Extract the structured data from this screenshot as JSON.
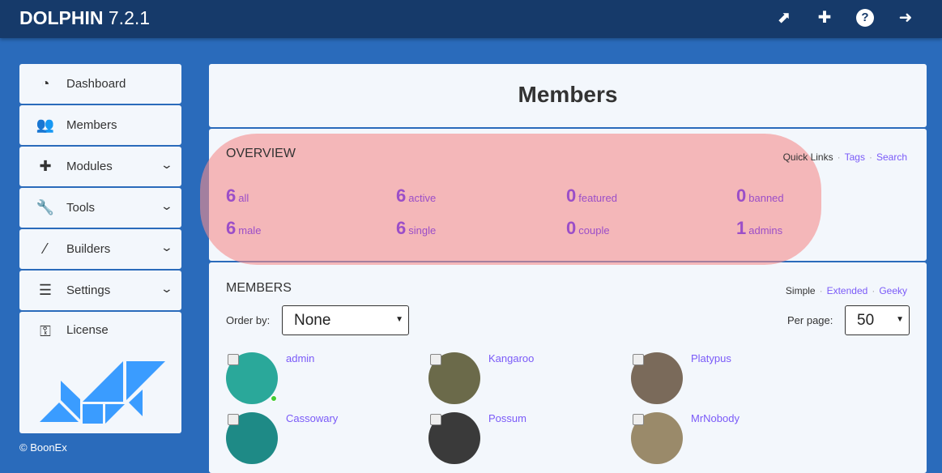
{
  "header": {
    "brand": "DOLPHIN",
    "version": "7.2.1"
  },
  "sidebar": {
    "items": [
      {
        "label": "Dashboard",
        "icon": "dashboard-icon",
        "glyph": "◔"
      },
      {
        "label": "Members",
        "icon": "users-icon",
        "glyph": "👥"
      },
      {
        "label": "Modules",
        "icon": "puzzle-icon",
        "glyph": "✚"
      },
      {
        "label": "Tools",
        "icon": "wrench-icon",
        "glyph": "🔧"
      },
      {
        "label": "Builders",
        "icon": "magic-wand-icon",
        "glyph": "⁄"
      },
      {
        "label": "Settings",
        "icon": "sliders-icon",
        "glyph": "☰"
      },
      {
        "label": "License",
        "icon": "key-icon",
        "glyph": "⚿"
      }
    ],
    "copyright": "© BoonEx"
  },
  "page": {
    "title": "Members"
  },
  "overview": {
    "title": "OVERVIEW",
    "quick_links": "Quick Links",
    "links": [
      "Tags",
      "Search"
    ],
    "stats": [
      {
        "n": "6",
        "l": "all"
      },
      {
        "n": "6",
        "l": "active"
      },
      {
        "n": "0",
        "l": "featured"
      },
      {
        "n": "0",
        "l": "banned"
      },
      {
        "n": "6",
        "l": "male"
      },
      {
        "n": "6",
        "l": "single"
      },
      {
        "n": "0",
        "l": "couple"
      },
      {
        "n": "1",
        "l": "admins"
      }
    ]
  },
  "members": {
    "title": "MEMBERS",
    "view_current": "Simple",
    "views": [
      "Extended",
      "Geeky"
    ],
    "order_label": "Order by:",
    "order_value": "None",
    "per_page_label": "Per page:",
    "per_page_value": "50",
    "list": [
      {
        "name": "admin",
        "color": "#2aa89a"
      },
      {
        "name": "Kangaroo",
        "color": "#6b6a4a"
      },
      {
        "name": "Platypus",
        "color": "#7a6a5a"
      },
      {
        "name": "Cassowary",
        "color": "#1e8a86"
      },
      {
        "name": "Possum",
        "color": "#3a3a3a"
      },
      {
        "name": "MrNobody",
        "color": "#9a8a6a"
      }
    ]
  }
}
